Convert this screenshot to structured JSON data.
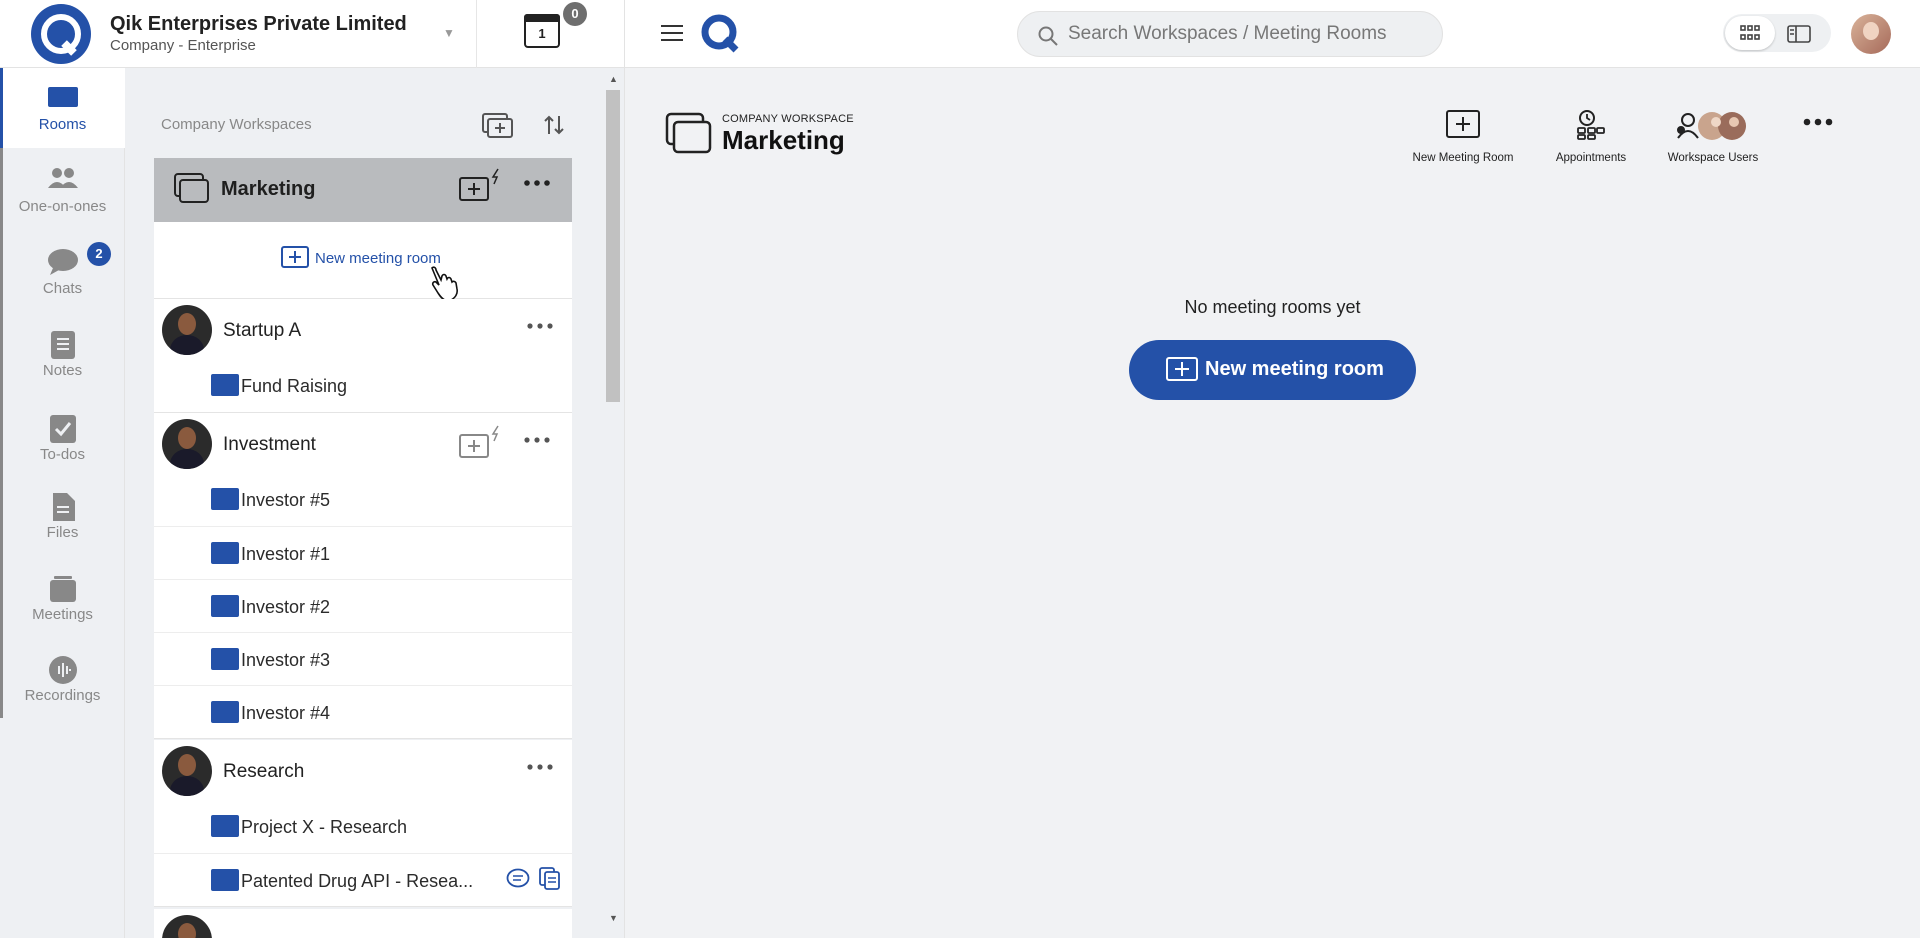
{
  "org": {
    "name": "Qik Enterprises Private Limited",
    "subtitle": "Company - Enterprise",
    "calendar_day": "1",
    "calendar_badge": "0"
  },
  "rail": {
    "items": [
      {
        "label": "Rooms",
        "icon": "rooms-icon",
        "active": true
      },
      {
        "label": "One-on-ones",
        "icon": "people-icon"
      },
      {
        "label": "Chats",
        "icon": "chat-icon",
        "badge": "2"
      },
      {
        "label": "Notes",
        "icon": "notes-icon"
      },
      {
        "label": "To-dos",
        "icon": "checkbox-icon"
      },
      {
        "label": "Files",
        "icon": "files-icon"
      },
      {
        "label": "Meetings",
        "icon": "meetings-icon"
      },
      {
        "label": "Recordings",
        "icon": "recordings-icon"
      }
    ]
  },
  "workspaces": {
    "heading": "Company Workspaces",
    "active": {
      "title": "Marketing",
      "new_room_label": "New meeting room"
    },
    "groups": [
      {
        "name": "Startup A",
        "rooms": [
          "Fund Raising"
        ]
      },
      {
        "name": "Investment",
        "rooms": [
          "Investor #5",
          "Investor #1",
          "Investor #2",
          "Investor #3",
          "Investor #4"
        ]
      },
      {
        "name": "Research",
        "rooms": [
          "Project X - Research",
          "Patented Drug API - Resea..."
        ]
      }
    ]
  },
  "topbar": {
    "search_placeholder": "Search Workspaces / Meeting Rooms"
  },
  "main": {
    "kicker": "COMPANY WORKSPACE",
    "title": "Marketing",
    "actions": {
      "new_room": "New Meeting Room",
      "appointments": "Appointments",
      "users": "Workspace Users"
    },
    "empty_text": "No meeting rooms yet",
    "new_room_button": "New meeting room"
  },
  "colors": {
    "accent": "#2451a8",
    "sidebar_bg": "#eef0f3",
    "card_head_bg": "#b9bbbe"
  }
}
